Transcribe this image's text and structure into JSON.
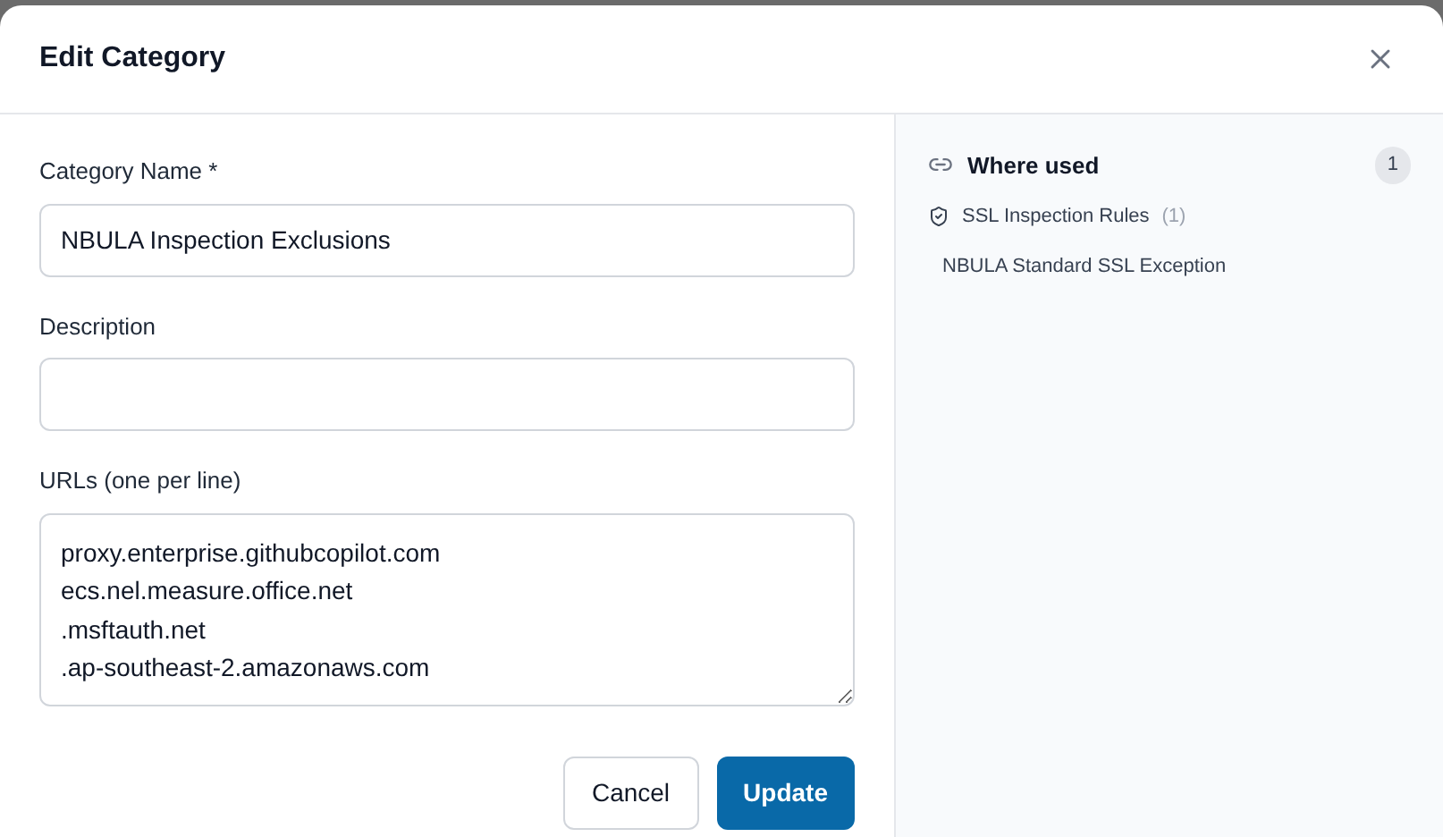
{
  "dialog": {
    "title": "Edit Category"
  },
  "form": {
    "fields": [
      {
        "kind": "input",
        "label": "Category Name *",
        "value": "NBULA Inspection Exclusions"
      },
      {
        "kind": "input",
        "label": "Description"
      },
      {
        "kind": "textarea",
        "label": "URLs (one per line)",
        "lines": [
          "proxy.enterprise.githubcopilot.com",
          "ecs.nel.measure.office.net",
          ".msftauth.net",
          ".ap-southeast-2.amazonaws.com"
        ]
      }
    ],
    "buttons": [
      {
        "label": "Cancel",
        "kind": "secondary"
      },
      {
        "label": "Update",
        "kind": "primary"
      }
    ]
  },
  "where_used": {
    "title": "Where used",
    "count": "1",
    "groups": [
      {
        "name": "SSL Inspection Rules",
        "count": "(1)",
        "items": [
          "NBULA Standard SSL Exception"
        ]
      }
    ]
  }
}
